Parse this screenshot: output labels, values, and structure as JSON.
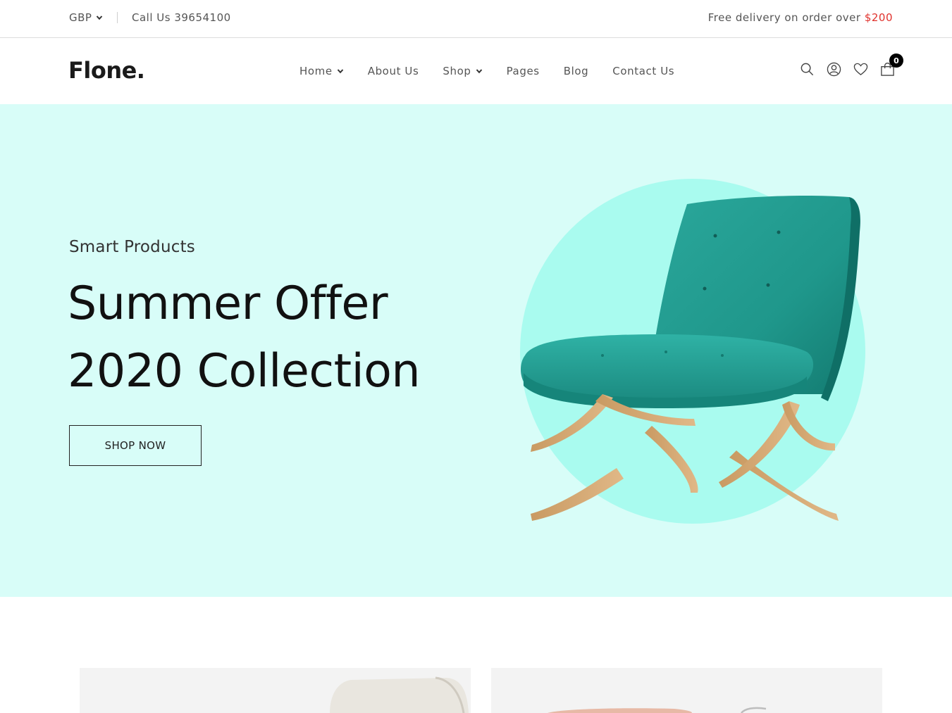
{
  "topbar": {
    "currency": "GBP",
    "call_us": "Call Us 39654100",
    "delivery_text": "Free delivery on order over ",
    "delivery_price": "$200"
  },
  "header": {
    "logo": "Flone.",
    "nav": [
      {
        "label": "Home",
        "has_dropdown": true
      },
      {
        "label": "About Us",
        "has_dropdown": false
      },
      {
        "label": "Shop",
        "has_dropdown": true
      },
      {
        "label": "Pages",
        "has_dropdown": false
      },
      {
        "label": "Blog",
        "has_dropdown": false
      },
      {
        "label": "Contact Us",
        "has_dropdown": false
      }
    ],
    "icons": [
      "search-icon",
      "user-icon",
      "heart-icon",
      "cart-icon"
    ],
    "cart_count": "0"
  },
  "hero": {
    "subtitle": "Smart Products",
    "title_line1": "Summer Offer",
    "title_line2": "2020 Collection",
    "button_label": "SHOP NOW",
    "background_color": "#d8fdf8",
    "circle_color": "#a9fbef",
    "image": "teal-upholstered-chair"
  },
  "colors": {
    "accent_price": "#e0312c",
    "text": "#333333"
  }
}
